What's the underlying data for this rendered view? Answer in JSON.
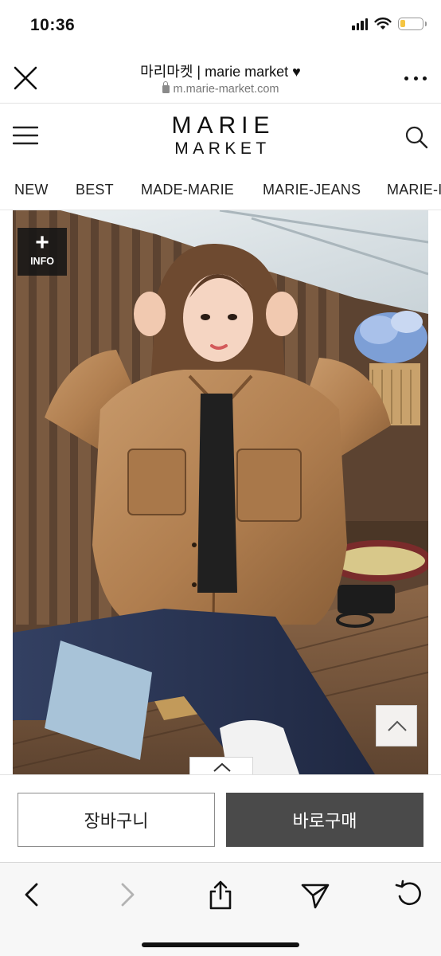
{
  "status_bar": {
    "time": "10:36",
    "battery_level": 0.25,
    "icons": [
      "signal-icon",
      "wifi-icon",
      "battery-icon"
    ]
  },
  "browser": {
    "title": "마리마켓 | marie market ♥",
    "url": "m.marie-market.com",
    "icons": [
      "close-icon",
      "lock-icon",
      "more-icon"
    ]
  },
  "site_header": {
    "logo_top": "MARIE",
    "logo_bottom": "MARKET",
    "icons": [
      "hamburger-menu-icon",
      "search-icon"
    ]
  },
  "category_nav": {
    "items": [
      "NEW",
      "BEST",
      "MADE-MARIE",
      "MARIE-JEANS",
      "MARIE-INNER"
    ]
  },
  "product": {
    "info_button_label": "INFO",
    "info_button_symbol": "+",
    "icons": [
      "plus-icon",
      "chevron-up-icon",
      "caret-up-icon"
    ]
  },
  "purchase_bar": {
    "cart_label": "장바구니",
    "buy_label": "바로구매"
  },
  "toolbar": {
    "icons": [
      "back-icon",
      "forward-icon",
      "share-icon",
      "send-icon",
      "reload-icon"
    ]
  },
  "colors": {
    "buy_button_bg": "#4a4a4a",
    "battery_fill": "#f5c542",
    "jacket_tan": "#b9895a",
    "jeans_navy": "#2b3550"
  }
}
